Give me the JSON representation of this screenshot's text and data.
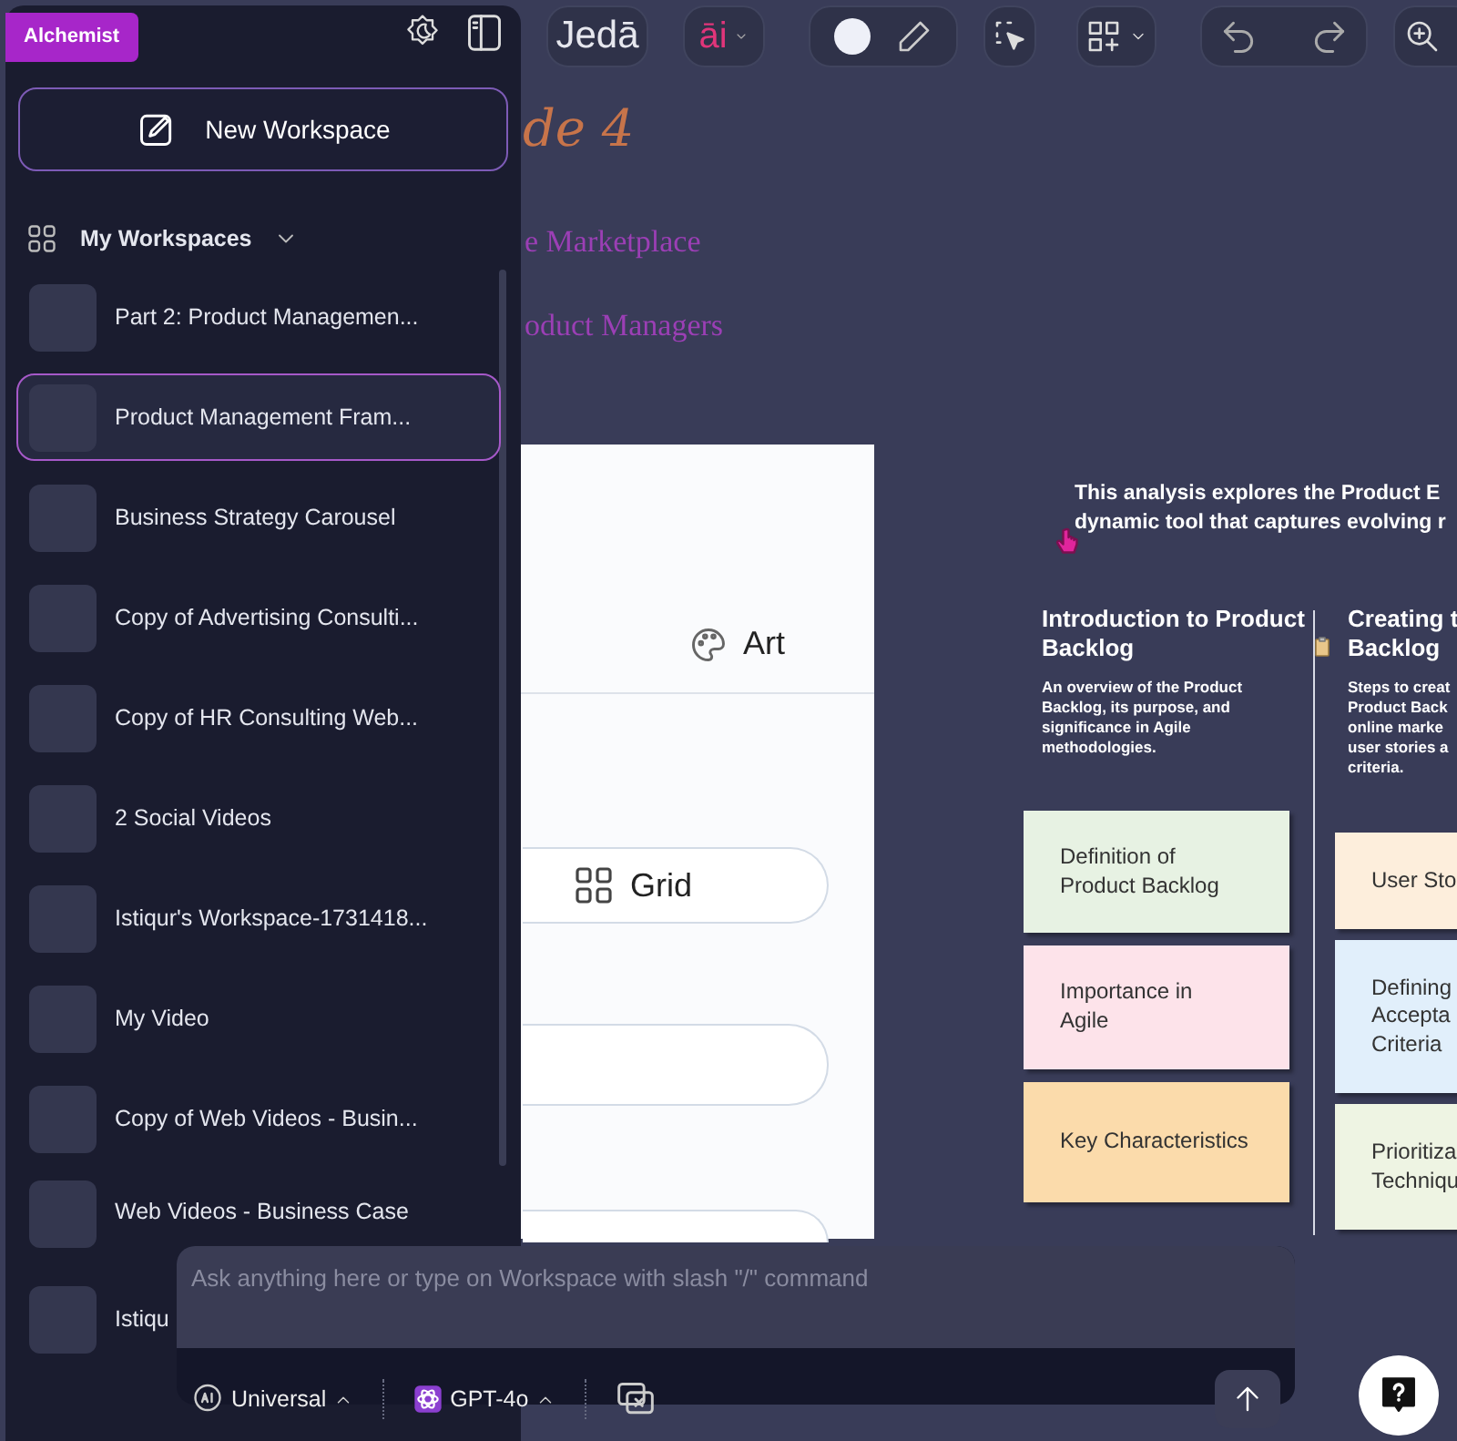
{
  "toolbar": {
    "logo": "Jedā",
    "ai_logo": "āi"
  },
  "canvas": {
    "title_fragments": [
      "de 4",
      "e Marketplace",
      "oduct Managers"
    ],
    "panel": {
      "art_label": "Art",
      "grid_label": "Grid"
    },
    "summary": "This analysis explores the Product E\ndynamic tool that captures evolving r",
    "columns": [
      {
        "title": "Introduction to Product\nBacklog",
        "description": "An overview of the Product Backlog, its purpose, and significance in Agile methodologies.",
        "notes": [
          {
            "text": "Definition of\nProduct Backlog",
            "color": "#e7f2e3"
          },
          {
            "text": "Importance in\nAgile",
            "color": "#fde3ea"
          },
          {
            "text": "Key Characteristics",
            "color": "#fbdbab"
          }
        ]
      },
      {
        "title": "Creating t\nBacklog",
        "description": "Steps to creat\nProduct Back\nonline marke\nuser stories a\ncriteria.",
        "notes": [
          {
            "text": "User Sto",
            "color": "#fdeedc"
          },
          {
            "text": "Defining\nAccepta\nCriteria",
            "color": "#e1effb"
          },
          {
            "text": "Prioritiza\nTechniqu",
            "color": "#eef4e3"
          }
        ]
      }
    ]
  },
  "sidebar": {
    "badge": "Alchemist",
    "new_workspace": "New Workspace",
    "section": {
      "label": "My Workspaces",
      "expanded": true
    },
    "workspaces": [
      {
        "title": "Part 2: Product Managemen...",
        "selected": false
      },
      {
        "title": "Product Management Fram...",
        "selected": true
      },
      {
        "title": "Business Strategy Carousel",
        "selected": false
      },
      {
        "title": "Copy of Advertising Consulti...",
        "selected": false
      },
      {
        "title": "Copy of HR Consulting Web...",
        "selected": false
      },
      {
        "title": "2 Social Videos",
        "selected": false
      },
      {
        "title": "Istiqur's Workspace-1731418...",
        "selected": false
      },
      {
        "title": "My Video",
        "selected": false
      },
      {
        "title": "Copy of Web Videos - Busin...",
        "selected": false
      },
      {
        "title": "Web Videos - Business Case",
        "selected": false
      },
      {
        "title": "Istiqu",
        "selected": false
      }
    ]
  },
  "chat": {
    "placeholder": "Ask anything here or type on Workspace with slash \"/\" command",
    "mode": "Universal",
    "model": "GPT-4o"
  }
}
